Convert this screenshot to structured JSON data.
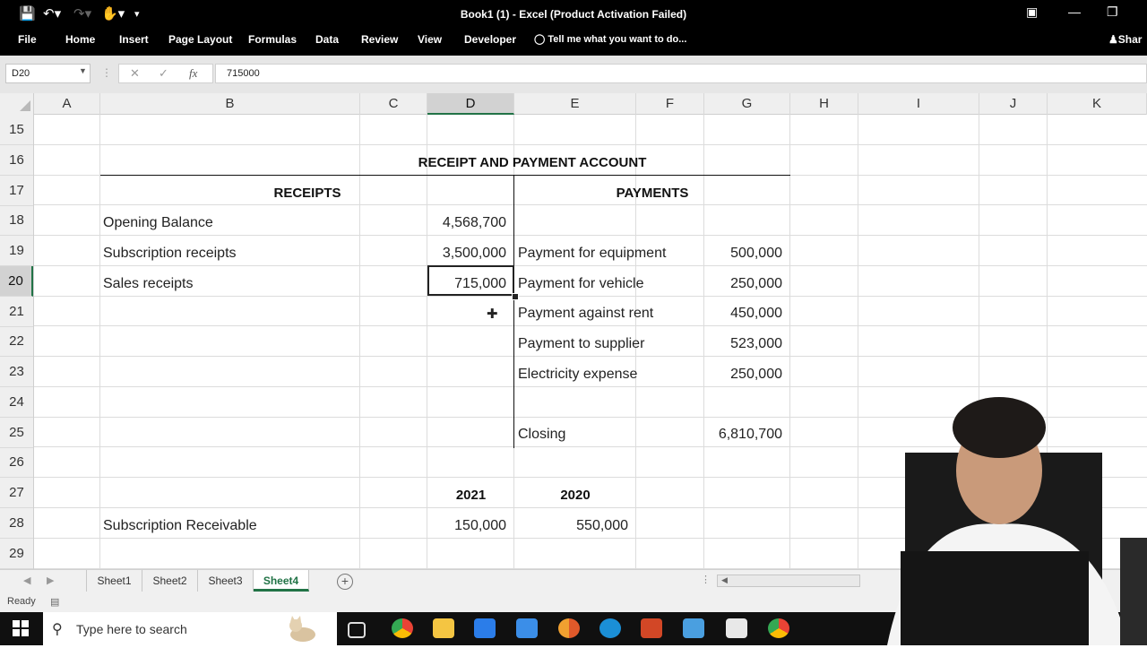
{
  "titlebar": {
    "title": "Book1 (1) - Excel (Product Activation Failed)"
  },
  "ribbon": {
    "tabs": [
      "File",
      "Home",
      "Insert",
      "Page Layout",
      "Formulas",
      "Data",
      "Review",
      "View",
      "Developer"
    ],
    "tell_me": "Tell me what you want to do...",
    "share": "Shar"
  },
  "formula_bar": {
    "name_box": "D20",
    "fx": "fx",
    "value": "715000"
  },
  "columns": [
    "A",
    "B",
    "C",
    "D",
    "E",
    "F",
    "G",
    "H",
    "I",
    "J",
    "K"
  ],
  "selected_column": "D",
  "rows": [
    "15",
    "16",
    "17",
    "18",
    "19",
    "20",
    "21",
    "22",
    "23",
    "24",
    "25",
    "26",
    "27",
    "28",
    "29"
  ],
  "selected_row": "20",
  "sheet": {
    "title": "RECEIPT AND PAYMENT ACCOUNT",
    "receipts_header": "RECEIPTS",
    "payments_header": "PAYMENTS",
    "receipts": [
      {
        "label": "Opening Balance",
        "amount": "4,568,700"
      },
      {
        "label": "Subscription receipts",
        "amount": "3,500,000"
      },
      {
        "label": "Sales receipts",
        "amount": "715,000"
      }
    ],
    "payments": [
      {
        "label": "Payment for equipment",
        "amount": "500,000"
      },
      {
        "label": "Payment for vehicle",
        "amount": "250,000"
      },
      {
        "label": "Payment against rent",
        "amount": "450,000"
      },
      {
        "label": "Payment to supplier",
        "amount": "523,000"
      },
      {
        "label": "Electricity expense",
        "amount": "250,000"
      }
    ],
    "closing_label": "Closing",
    "closing_amount": "6,810,700",
    "year_2021": "2021",
    "year_2020": "2020",
    "subscription_receivable_label": "Subscription Receivable",
    "subscription_receivable_2021": "150,000",
    "subscription_receivable_2020": "550,000"
  },
  "sheet_tabs": [
    "Sheet1",
    "Sheet2",
    "Sheet3",
    "Sheet4"
  ],
  "active_sheet": "Sheet4",
  "status": {
    "text": "Ready"
  },
  "taskbar": {
    "search_placeholder": "Type here to search",
    "icons": [
      "task-view-icon",
      "chrome-icon",
      "file-explorer-icon",
      "store-icon",
      "mail-icon",
      "chrome-canary-icon",
      "edge-icon",
      "powerpoint-icon",
      "photos-icon",
      "notepad-icon",
      "chrome-icon"
    ]
  },
  "colors": {
    "excel_green": "#217346",
    "titlebar_bg": "#000000",
    "taskbar_bg": "#101010"
  }
}
